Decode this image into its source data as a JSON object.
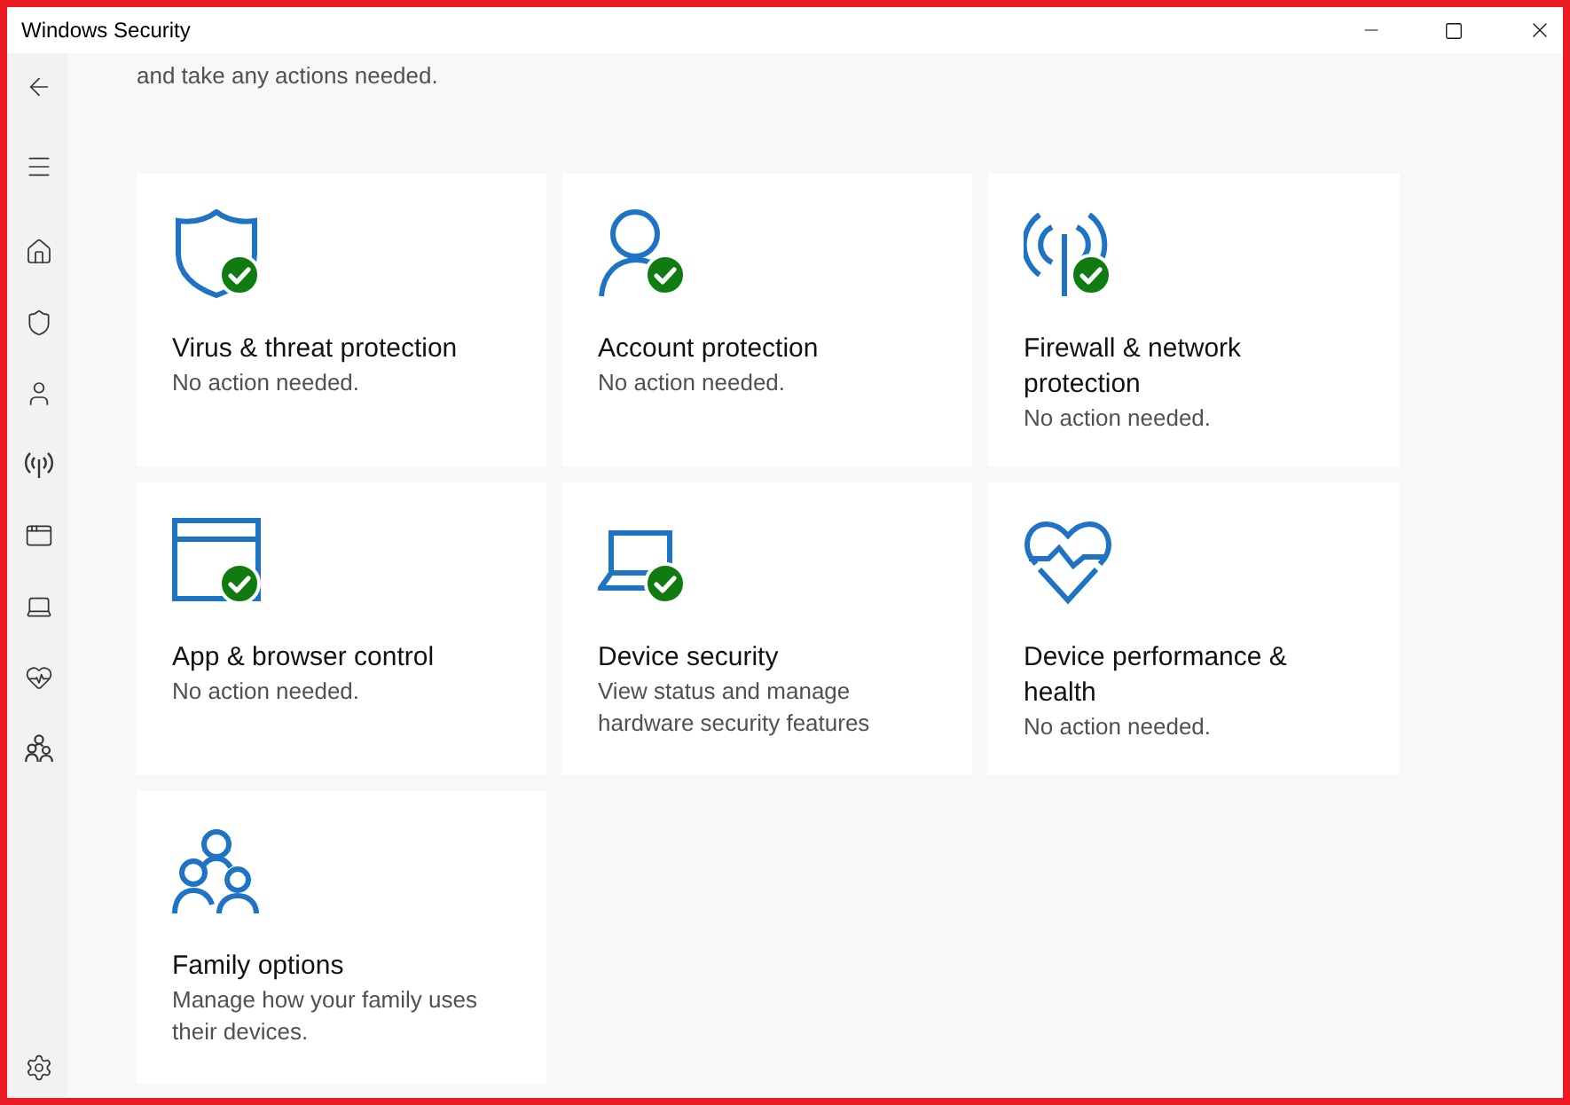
{
  "window": {
    "title": "Windows Security"
  },
  "content": {
    "intro_text": "and take any actions needed.",
    "cards": [
      {
        "kind": "shield",
        "title": "Virus & threat protection",
        "status": "No action needed.",
        "healthy": true
      },
      {
        "kind": "person",
        "title": "Account protection",
        "status": "No action needed.",
        "healthy": true
      },
      {
        "kind": "antenna",
        "title": "Firewall & network protection",
        "status": "No action needed.",
        "healthy": true
      },
      {
        "kind": "browser",
        "title": "App & browser control",
        "status": "No action needed.",
        "healthy": true
      },
      {
        "kind": "laptop",
        "title": "Device security",
        "status": "View status and manage hardware security features",
        "healthy": true
      },
      {
        "kind": "heart",
        "title": "Device performance & health",
        "status": "No action needed.",
        "healthy": false
      },
      {
        "kind": "family",
        "title": "Family options",
        "status": "Manage how your family uses their devices.",
        "healthy": false
      }
    ]
  }
}
